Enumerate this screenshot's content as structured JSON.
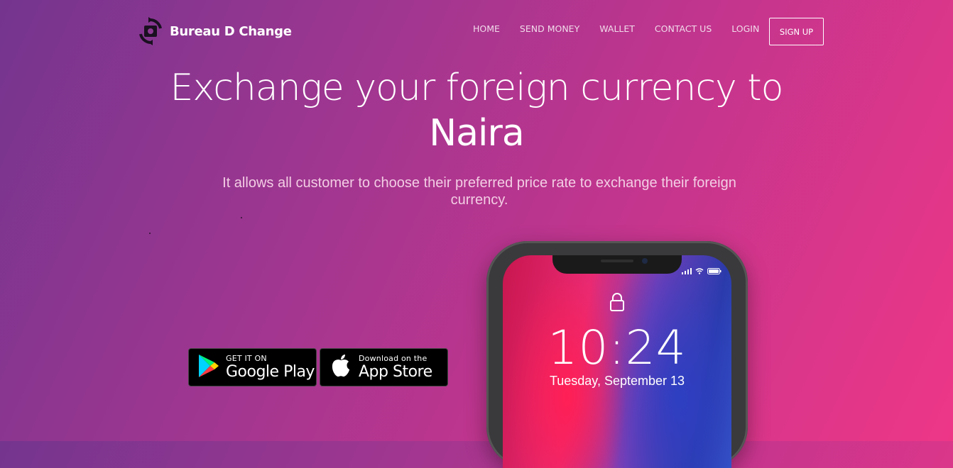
{
  "brand": {
    "name": "Bureau D Change",
    "icon": "currency-exchange-icon"
  },
  "nav": {
    "items": [
      {
        "label": "HOME"
      },
      {
        "label": "SEND MONEY"
      },
      {
        "label": "WALLET"
      },
      {
        "label": "CONTACT US"
      },
      {
        "label": "LOGIN"
      }
    ],
    "signup_label": "SIGN UP"
  },
  "hero": {
    "headline_line1": "Exchange your foreign currency to",
    "headline_line2": "Naira",
    "subtitle": "It allows all customer to choose their preferred price rate to exchange their foreign currency."
  },
  "stores": {
    "google": {
      "small": "GET IT ON",
      "big": "Google Play",
      "icon": "google-play-icon"
    },
    "apple": {
      "small": "Download on the",
      "big": "App Store",
      "icon": "apple-icon"
    }
  },
  "phone": {
    "time": "10:24",
    "date": "Tuesday, September 13"
  },
  "colors": {
    "gradient_start": "#74358f",
    "gradient_end": "#ee3687"
  }
}
